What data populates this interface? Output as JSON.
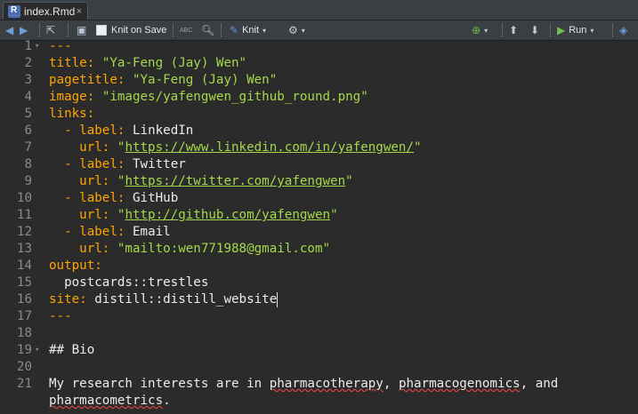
{
  "tab": {
    "filename": "index.Rmd",
    "close": "×"
  },
  "toolbar": {
    "knit_on_save": "Knit on Save",
    "spell_label": "ABC",
    "knit": "Knit",
    "run": "Run"
  },
  "editor": {
    "lines": [
      {
        "n": "1",
        "seg": [
          {
            "t": "---",
            "c": "k"
          }
        ]
      },
      {
        "n": "2",
        "seg": [
          {
            "t": "title",
            "c": "k"
          },
          {
            "t": ": ",
            "c": "k"
          },
          {
            "t": "\"Ya-Feng (Jay) Wen\"",
            "c": "s"
          }
        ]
      },
      {
        "n": "3",
        "seg": [
          {
            "t": "pagetitle",
            "c": "k"
          },
          {
            "t": ": ",
            "c": "k"
          },
          {
            "t": "\"Ya-Feng (Jay) Wen\"",
            "c": "s"
          }
        ]
      },
      {
        "n": "4",
        "seg": [
          {
            "t": "image",
            "c": "k"
          },
          {
            "t": ": ",
            "c": "k"
          },
          {
            "t": "\"images/yafengwen_github_round.png\"",
            "c": "s"
          }
        ]
      },
      {
        "n": "5",
        "seg": [
          {
            "t": "links",
            "c": "k"
          },
          {
            "t": ":",
            "c": "k"
          }
        ]
      },
      {
        "n": "6",
        "seg": [
          {
            "t": "  - ",
            "c": "k"
          },
          {
            "t": "label",
            "c": "k"
          },
          {
            "t": ": ",
            "c": "k"
          },
          {
            "t": "LinkedIn",
            "c": "p"
          }
        ]
      },
      {
        "n": "7",
        "seg": [
          {
            "t": "    url",
            "c": "k"
          },
          {
            "t": ": ",
            "c": "k"
          },
          {
            "t": "\"",
            "c": "s"
          },
          {
            "t": "https://www.linkedin.com/in/yafengwen/",
            "c": "u"
          },
          {
            "t": "\"",
            "c": "s"
          }
        ]
      },
      {
        "n": "8",
        "seg": [
          {
            "t": "  - ",
            "c": "k"
          },
          {
            "t": "label",
            "c": "k"
          },
          {
            "t": ": ",
            "c": "k"
          },
          {
            "t": "Twitter",
            "c": "p"
          }
        ]
      },
      {
        "n": "9",
        "seg": [
          {
            "t": "    url",
            "c": "k"
          },
          {
            "t": ": ",
            "c": "k"
          },
          {
            "t": "\"",
            "c": "s"
          },
          {
            "t": "https://twitter.com/yafengwen",
            "c": "u"
          },
          {
            "t": "\"",
            "c": "s"
          }
        ]
      },
      {
        "n": "10",
        "seg": [
          {
            "t": "  - ",
            "c": "k"
          },
          {
            "t": "label",
            "c": "k"
          },
          {
            "t": ": ",
            "c": "k"
          },
          {
            "t": "GitHub",
            "c": "p"
          }
        ]
      },
      {
        "n": "11",
        "seg": [
          {
            "t": "    url",
            "c": "k"
          },
          {
            "t": ": ",
            "c": "k"
          },
          {
            "t": "\"",
            "c": "s"
          },
          {
            "t": "http://github.com/yafengwen",
            "c": "u"
          },
          {
            "t": "\"",
            "c": "s"
          }
        ]
      },
      {
        "n": "12",
        "seg": [
          {
            "t": "  - ",
            "c": "k"
          },
          {
            "t": "label",
            "c": "k"
          },
          {
            "t": ": ",
            "c": "k"
          },
          {
            "t": "Email",
            "c": "p"
          }
        ]
      },
      {
        "n": "13",
        "seg": [
          {
            "t": "    url",
            "c": "k"
          },
          {
            "t": ": ",
            "c": "k"
          },
          {
            "t": "\"mailto:wen771988@gmail.com\"",
            "c": "s"
          }
        ]
      },
      {
        "n": "14",
        "seg": [
          {
            "t": "output",
            "c": "k"
          },
          {
            "t": ":",
            "c": "k"
          }
        ]
      },
      {
        "n": "15",
        "seg": [
          {
            "t": "  postcards::trestles",
            "c": "p"
          }
        ]
      },
      {
        "n": "16",
        "seg": [
          {
            "t": "site",
            "c": "k"
          },
          {
            "t": ": ",
            "c": "k"
          },
          {
            "t": "distill::distill_website",
            "c": "p"
          },
          {
            "t": "",
            "c": "cursor"
          }
        ]
      },
      {
        "n": "17",
        "seg": [
          {
            "t": "---",
            "c": "k"
          }
        ]
      },
      {
        "n": "18",
        "seg": []
      },
      {
        "n": "19",
        "seg": [
          {
            "t": "## Bio",
            "c": "p"
          }
        ]
      },
      {
        "n": "20",
        "seg": []
      },
      {
        "n": "21",
        "seg": [
          {
            "t": "My research interests are in ",
            "c": "p"
          },
          {
            "t": "pharmacotherapy",
            "c": "sq"
          },
          {
            "t": ", ",
            "c": "p"
          },
          {
            "t": "pharmacogenomics",
            "c": "sq"
          },
          {
            "t": ", and",
            "c": "p"
          }
        ]
      },
      {
        "n": "",
        "seg": [
          {
            "t": "pharmacometrics",
            "c": "sq"
          },
          {
            "t": ".",
            "c": "p"
          }
        ]
      }
    ],
    "fold_lines": [
      "1",
      "19"
    ],
    "colors": {
      "keyword": "#ffa500",
      "string": "#a6d84b",
      "plain": "#ececec",
      "background": "#2b2b2b"
    }
  }
}
